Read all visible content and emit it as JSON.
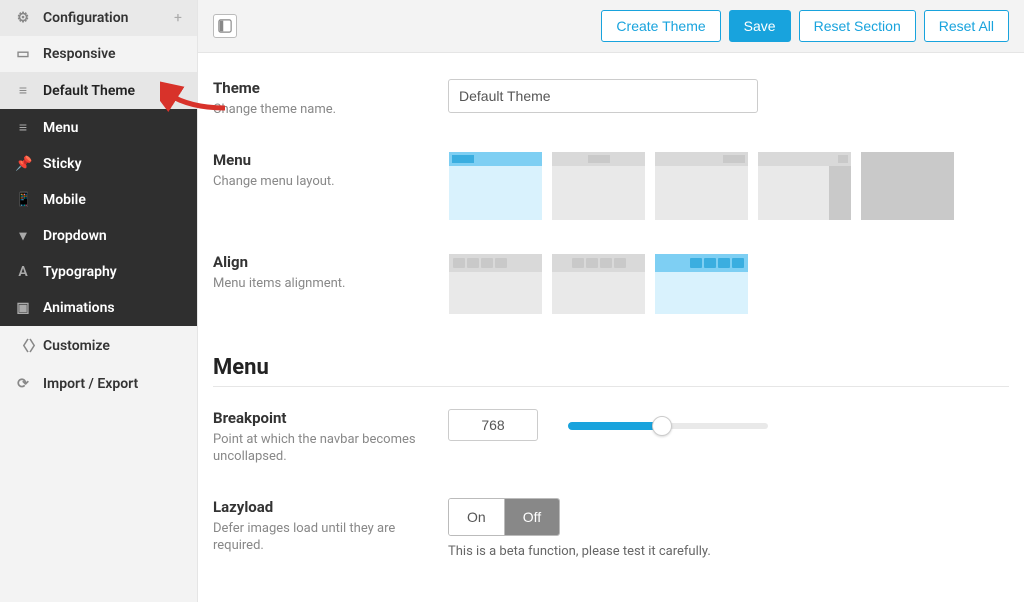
{
  "sidebar": {
    "items": [
      {
        "label": "Configuration",
        "icon": "gear",
        "plus": "+"
      },
      {
        "label": "Responsive",
        "icon": "device"
      },
      {
        "label": "Default Theme",
        "icon": "menu",
        "active": true
      },
      {
        "label": "Menu",
        "icon": "menu",
        "sub": true
      },
      {
        "label": "Sticky",
        "icon": "pin",
        "sub": true
      },
      {
        "label": "Mobile",
        "icon": "mobile",
        "sub": true
      },
      {
        "label": "Dropdown",
        "icon": "drop",
        "sub": true
      },
      {
        "label": "Typography",
        "icon": "type",
        "sub": true
      },
      {
        "label": "Animations",
        "icon": "anim",
        "sub": true
      },
      {
        "label": "Customize",
        "icon": "code"
      },
      {
        "label": "Import / Export",
        "icon": "sync"
      }
    ]
  },
  "toolbar": {
    "create_label": "Create Theme",
    "save_label": "Save",
    "reset_section_label": "Reset Section",
    "reset_all_label": "Reset All"
  },
  "theme": {
    "title": "Theme",
    "desc": "Change theme name.",
    "value": "Default Theme"
  },
  "menu_layout": {
    "title": "Menu",
    "desc": "Change menu layout.",
    "selected": 0,
    "options": [
      {
        "kind": "topbar-left",
        "sidebar": ""
      },
      {
        "kind": "topbar-center",
        "sidebar": ""
      },
      {
        "kind": "topbar-right",
        "sidebar": ""
      },
      {
        "kind": "right-side",
        "sidebar": "right"
      },
      {
        "kind": "full-gray",
        "sidebar": ""
      }
    ]
  },
  "align": {
    "title": "Align",
    "desc": "Menu items alignment.",
    "selected": 2,
    "options": [
      "left",
      "center",
      "right"
    ]
  },
  "section_menu_title": "Menu",
  "breakpoint": {
    "title": "Breakpoint",
    "desc": "Point at which the navbar becomes uncollapsed.",
    "value": "768"
  },
  "lazyload": {
    "title": "Lazyload",
    "desc": "Defer images load until they are required.",
    "on_label": "On",
    "off_label": "Off",
    "selected": "off",
    "note": "This is a beta function, please test it carefully."
  }
}
